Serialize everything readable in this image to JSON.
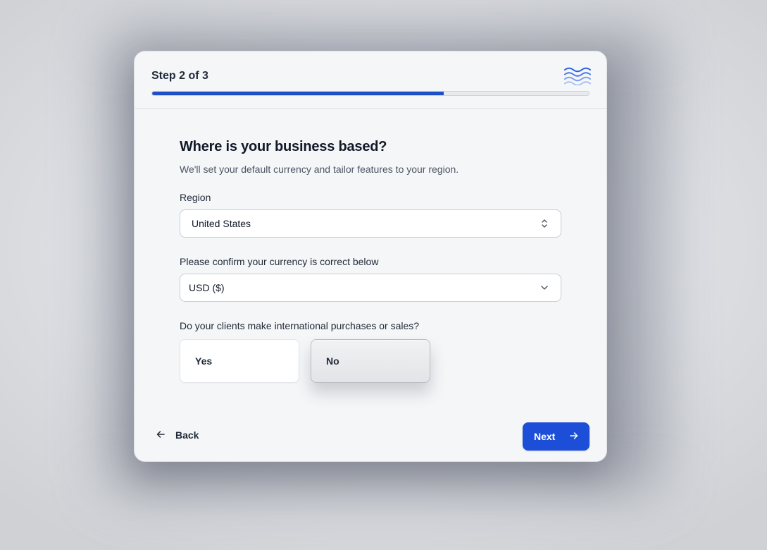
{
  "header": {
    "step_label": "Step 2 of 3",
    "progress_fraction": 0.667,
    "logo_icon": "waves-logo-icon"
  },
  "question": {
    "title": "Where is your business based?",
    "subtitle": "We'll set your default currency and tailor features to your region."
  },
  "region": {
    "label": "Region",
    "value": "United States",
    "caret_icon": "chevron-up-down-icon"
  },
  "currency": {
    "label": "Please confirm your currency is correct below",
    "value": "USD ($)",
    "caret_icon": "chevron-down-icon"
  },
  "international": {
    "label": "Do your clients make international purchases or sales?",
    "options": [
      {
        "label": "Yes",
        "selected": false
      },
      {
        "label": "No",
        "selected": true
      }
    ]
  },
  "footer": {
    "back_label": "Back",
    "back_icon": "arrow-left-icon",
    "next_label": "Next",
    "next_icon": "arrow-right-icon"
  },
  "colors": {
    "accent": "#1d4ed8",
    "progress": "#1f4fc7",
    "logo": "#3b6be0"
  }
}
